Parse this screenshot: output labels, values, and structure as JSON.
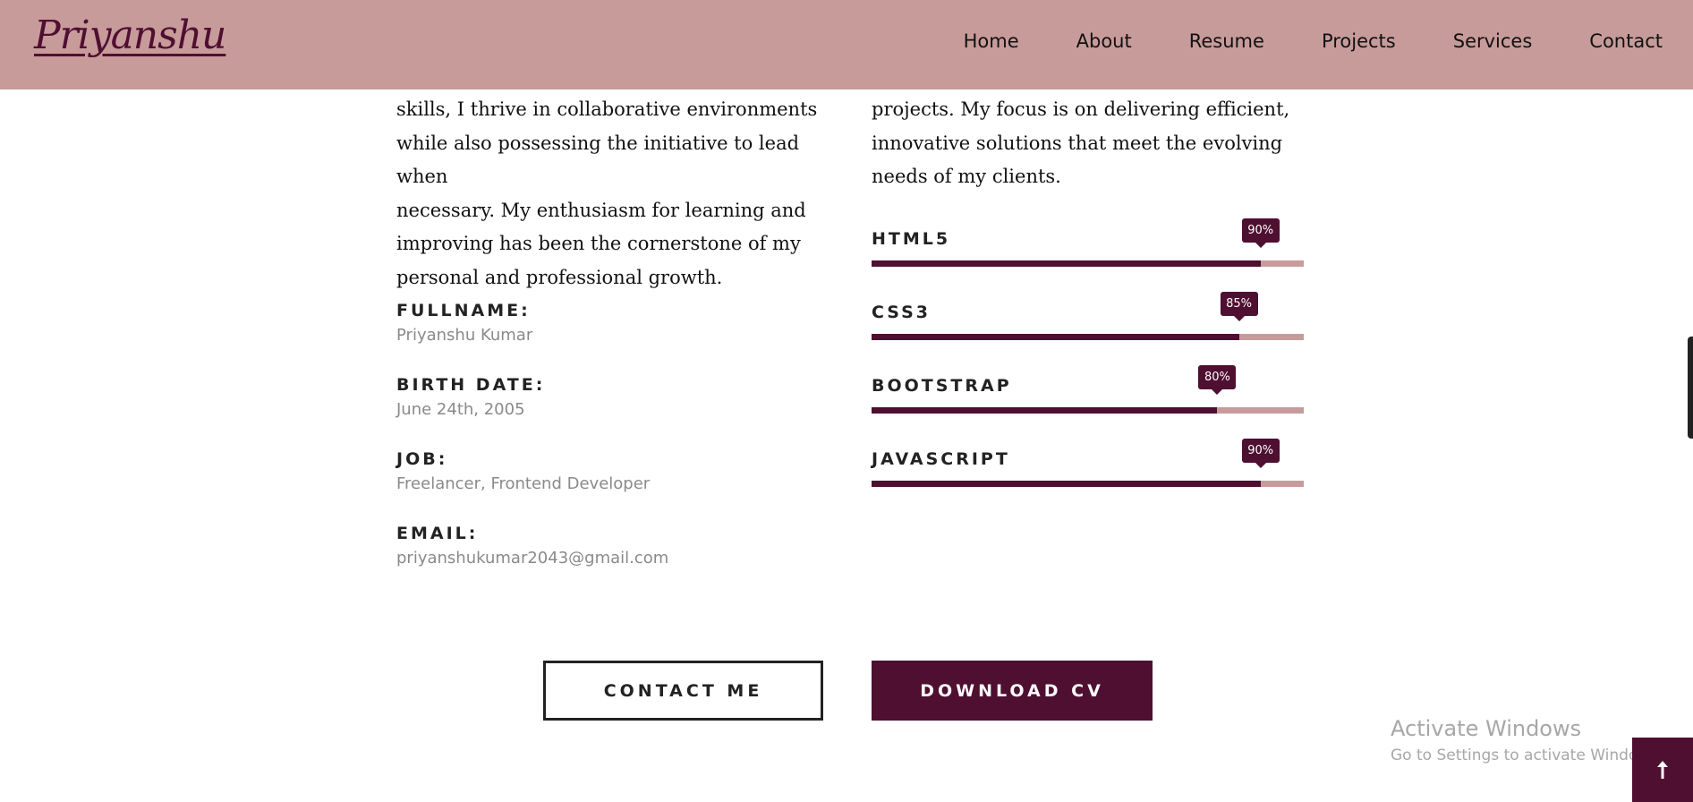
{
  "header": {
    "logo": "Priyanshu",
    "nav": [
      "Home",
      "About",
      "Resume",
      "Projects",
      "Services",
      "Contact"
    ]
  },
  "about": {
    "left_lines": [
      "skills, I thrive in collaborative environments",
      "while also possessing the initiative to lead when",
      "necessary. My enthusiasm for learning and",
      "improving has been the cornerstone of my",
      "personal and professional growth."
    ],
    "right_lines": [
      "projects. My focus is on delivering efficient,",
      "innovative solutions that meet the evolving",
      "needs of my clients."
    ]
  },
  "info": [
    {
      "label": "FULLNAME:",
      "value": "Priyanshu Kumar"
    },
    {
      "label": "BIRTH DATE:",
      "value": "June 24th, 2005"
    },
    {
      "label": "JOB:",
      "value": "Freelancer, Frontend Developer"
    },
    {
      "label": "EMAIL:",
      "value": "priyanshukumar2043@gmail.com"
    }
  ],
  "skills": [
    {
      "name": "HTML5",
      "percent": 90,
      "percent_label": "90%"
    },
    {
      "name": "CSS3",
      "percent": 85,
      "percent_label": "85%"
    },
    {
      "name": "BOOTSTRAP",
      "percent": 80,
      "percent_label": "80%"
    },
    {
      "name": "JAVASCRIPT",
      "percent": 90,
      "percent_label": "90%"
    }
  ],
  "buttons": {
    "contact": "CONTACT ME",
    "download": "DOWNLOAD CV"
  },
  "watermark": {
    "title": "Activate Windows",
    "subtitle": "Go to Settings to activate Windows."
  },
  "back_to_top": {
    "icon": "arrow-up-icon"
  },
  "colors": {
    "header_bg": "#c89b9b",
    "accent": "#4f0f31",
    "track": "#c89b9b"
  }
}
